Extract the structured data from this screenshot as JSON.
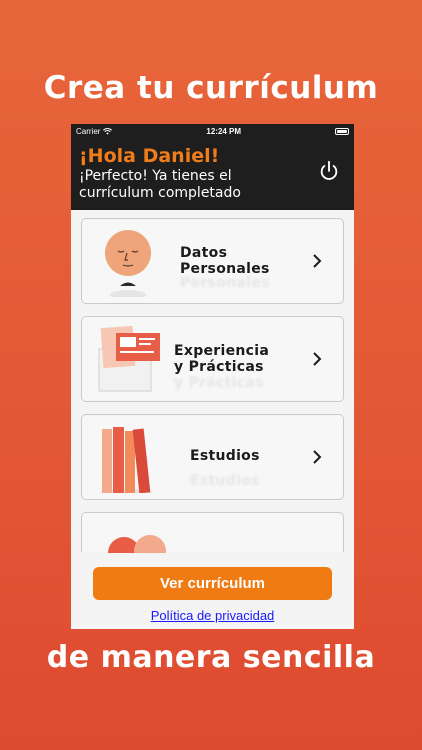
{
  "promo": {
    "top_text": "Crea tu currículum",
    "bottom_text": "de manera sencilla"
  },
  "status_bar": {
    "carrier": "Carrier",
    "time": "12:24 PM"
  },
  "header": {
    "greeting": "¡Hola Daniel!",
    "message": "¡Perfecto! Ya tienes el currículum completado",
    "power_icon": "power-icon"
  },
  "sections": [
    {
      "line1": "Datos",
      "line2": "Personales",
      "icon": "face-icon"
    },
    {
      "line1": "Experiencia",
      "line2": "y Prácticas",
      "icon": "documents-icon"
    },
    {
      "line1": "Estudios",
      "line2": "",
      "icon": "books-icon"
    }
  ],
  "footer": {
    "cta_label": "Ver currículum",
    "privacy_label": "Política de privacidad"
  },
  "colors": {
    "accent": "#ef7b12",
    "header_bg": "#1e1e1e",
    "background": "#e35a36"
  }
}
